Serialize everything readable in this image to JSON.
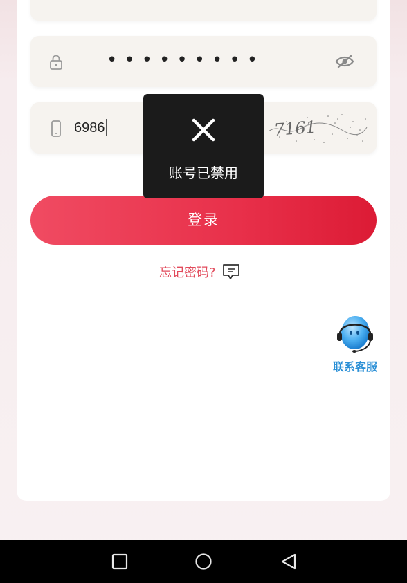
{
  "form": {
    "username_value": "",
    "password_mask": "•••••••••",
    "code_value": "6986",
    "captcha_text": "7161"
  },
  "login": {
    "label": "登录"
  },
  "forgot": {
    "label": "忘记密码?"
  },
  "support": {
    "label": "联系客服"
  },
  "toast": {
    "message": "账号已禁用"
  },
  "colors": {
    "accent": "#e8304a",
    "link": "#e24b5c",
    "support": "#2a8fd6",
    "toast_bg": "#1b1b1b"
  },
  "icons": {
    "username": "user-icon",
    "password": "lock-icon",
    "visibility": "eye-off-icon",
    "code": "phone-icon",
    "forgot": "chat-bubble-icon",
    "support": "headset-icon",
    "toast": "close-icon",
    "nav": [
      "square-icon",
      "circle-icon",
      "triangle-back-icon"
    ]
  }
}
